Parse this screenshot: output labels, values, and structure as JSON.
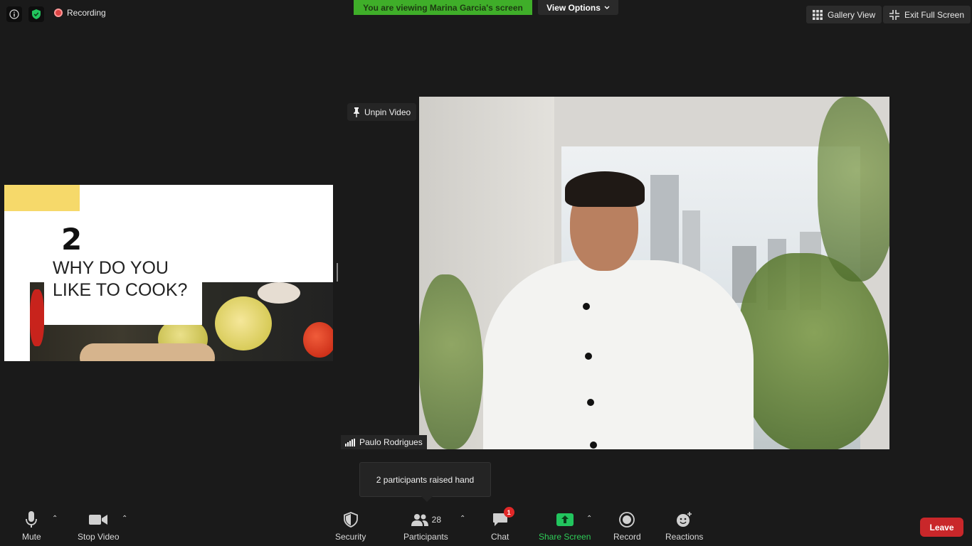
{
  "top_left": {
    "recording_label": "Recording"
  },
  "banner": {
    "viewing_text": "You are viewing Marina Garcia's screen",
    "view_options_label": "View Options"
  },
  "top_right": {
    "gallery_view_label": "Gallery View",
    "exit_full_screen_label": "Exit Full Screen"
  },
  "shared_slide": {
    "number": "2",
    "question_line1": "WHY DO YOU",
    "question_line2": "LIKE TO COOK?"
  },
  "video": {
    "unpin_label": "Unpin Video",
    "participant_name": "Paulo Rodrigues"
  },
  "tooltip": {
    "text": "2 participants raised hand"
  },
  "toolbar": {
    "mute_label": "Mute",
    "stop_video_label": "Stop Video",
    "security_label": "Security",
    "participants_label": "Participants",
    "participants_count": "28",
    "chat_label": "Chat",
    "chat_badge": "1",
    "share_screen_label": "Share Screen",
    "record_label": "Record",
    "reactions_label": "Reactions",
    "leave_label": "Leave"
  },
  "colors": {
    "banner_green": "#3fae29",
    "share_green": "#22c55e",
    "leave_red": "#c9272a",
    "badge_red": "#e02828"
  }
}
